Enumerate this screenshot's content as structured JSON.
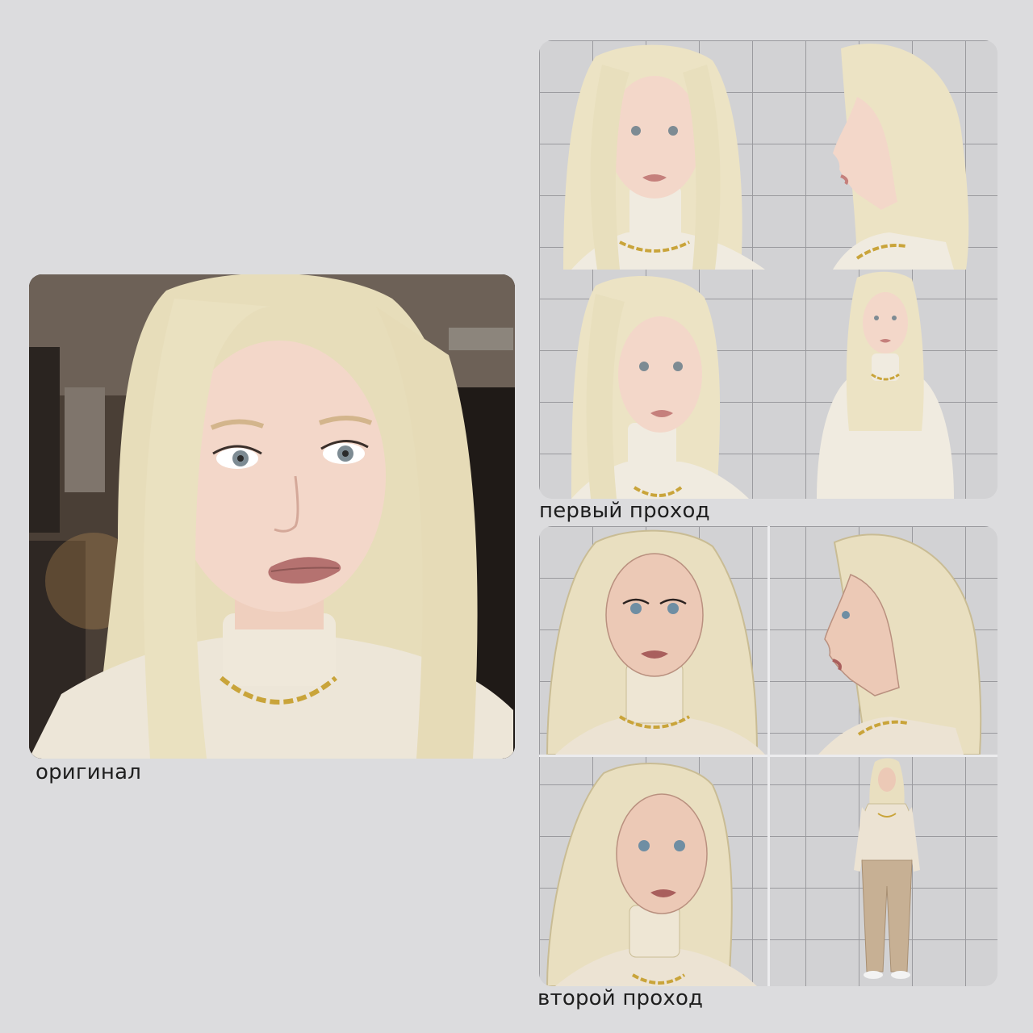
{
  "captions": {
    "original": "оригинал",
    "first_pass": "первый проход",
    "second_pass": "второй проход"
  },
  "images": {
    "original": "photo-blonde-girl-selfie",
    "first_pass": [
      "front-portrait",
      "side-profile",
      "three-quarter-portrait",
      "upper-body-front"
    ],
    "second_pass": [
      "front-portrait-illustrated",
      "side-profile-illustrated",
      "three-quarter-illustrated",
      "full-body-illustrated"
    ]
  },
  "colors": {
    "background": "#dcdcde",
    "hair": "#ece3c4",
    "skin": "#f1d6c9",
    "sweater": "#f0ebe0",
    "chain": "#c9a43a",
    "pants": "#c7b094"
  }
}
